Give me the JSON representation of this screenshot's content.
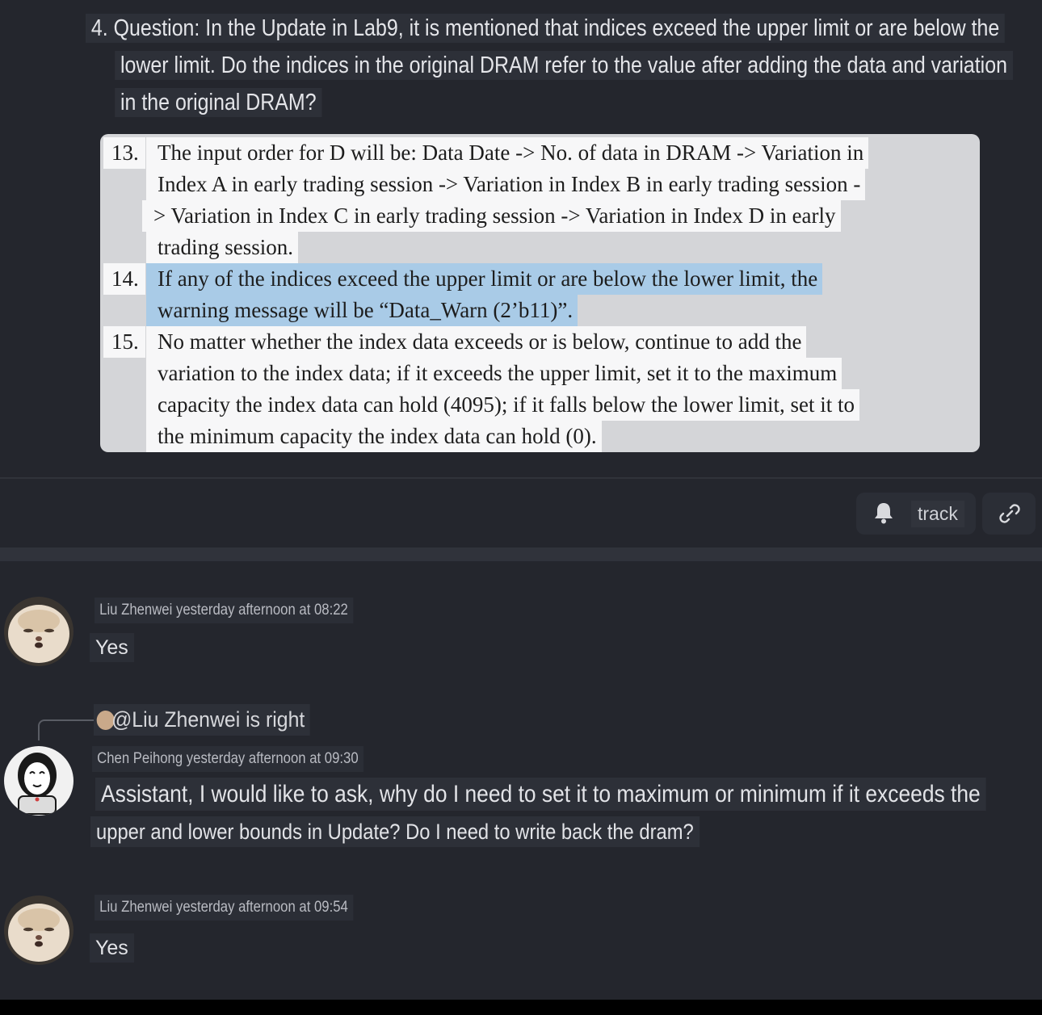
{
  "question": {
    "lines": [
      "4. Question: In the Update in Lab9, it is mentioned that indices exceed the upper limit or are below the",
      "lower limit. Do the indices in the original DRAM refer to the value after adding the data and variation",
      "in the original DRAM?"
    ]
  },
  "document": {
    "items": [
      {
        "num": "13.",
        "lines": [
          "The input order for D will be: Data Date -> No. of data in DRAM -> Variation in",
          "Index A in early trading session -> Variation in Index B in early trading session -",
          "> Variation in Index C in early trading session -> Variation in Index D in early",
          "trading session."
        ]
      },
      {
        "num": "14.",
        "lines": [
          "If any of the indices exceed the upper limit or are below the lower limit, the",
          "warning message will be “Data_Warn (2’b11)”."
        ]
      },
      {
        "num": "15.",
        "lines": [
          "No matter whether the index data exceeds or is below, continue to add the",
          "variation to the index data; if it exceeds the upper limit, set it to the maximum",
          "capacity the index data can hold (4095); if it falls below the lower limit, set it to",
          "the minimum capacity the index data can hold (0)."
        ]
      }
    ],
    "highlight_color": "#a9cbe7"
  },
  "actions": {
    "track_label": "track",
    "bell_icon": "bell-icon",
    "link_icon": "link-icon"
  },
  "comments": [
    {
      "author_time": "Liu Zhenwei yesterday afternoon at 08:22",
      "text": "Yes"
    },
    {
      "reply_to": "@Liu Zhenwei is right",
      "author_time": "Chen Peihong yesterday afternoon at 09:30",
      "lines": [
        "Assistant, I would like to ask, why do I need to set it to maximum or minimum if it exceeds the",
        "upper and lower bounds in Update? Do I need to write back the dram?"
      ]
    },
    {
      "author_time": "Liu Zhenwei yesterday afternoon at 09:54",
      "text": "Yes"
    }
  ]
}
